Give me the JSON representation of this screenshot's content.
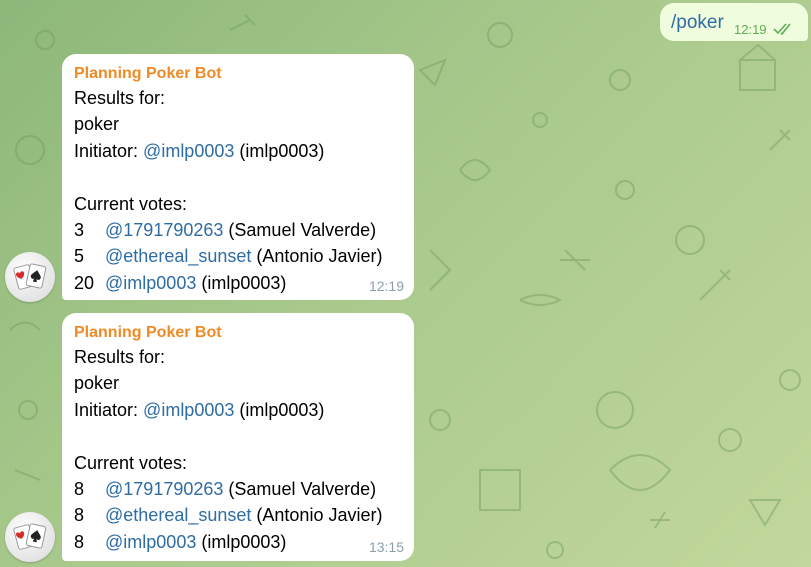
{
  "outgoing": {
    "text": "/poker",
    "time": "12:19",
    "status_icon": "double-check-icon"
  },
  "messages": [
    {
      "sender": "Planning Poker Bot",
      "results_label": "Results for:",
      "topic": "poker",
      "initiator_label": "Initiator:",
      "initiator_mention": "@imlp0003",
      "initiator_name": "(imlp0003)",
      "votes_label": "Current votes:",
      "votes": [
        {
          "value": "3",
          "mention": "@1791790263",
          "name": "(Samuel Valverde)"
        },
        {
          "value": "5",
          "mention": "@ethereal_sunset",
          "name": "(Antonio Javier)"
        },
        {
          "value": "20",
          "mention": "@imlp0003",
          "name": "(imlp0003)"
        }
      ],
      "time": "12:19"
    },
    {
      "sender": "Planning Poker Bot",
      "results_label": "Results for:",
      "topic": "poker",
      "initiator_label": "Initiator:",
      "initiator_mention": "@imlp0003",
      "initiator_name": "(imlp0003)",
      "votes_label": "Current votes:",
      "votes": [
        {
          "value": "8",
          "mention": "@1791790263",
          "name": "(Samuel Valverde)"
        },
        {
          "value": "8",
          "mention": "@ethereal_sunset",
          "name": "(Antonio Javier)"
        },
        {
          "value": "8",
          "mention": "@imlp0003",
          "name": "(imlp0003)"
        }
      ],
      "time": "13:15"
    }
  ],
  "colors": {
    "sender": "#f08a24",
    "mention": "#2e6ca4",
    "outgoing_bg": "#effdde",
    "check": "#5fae54"
  }
}
